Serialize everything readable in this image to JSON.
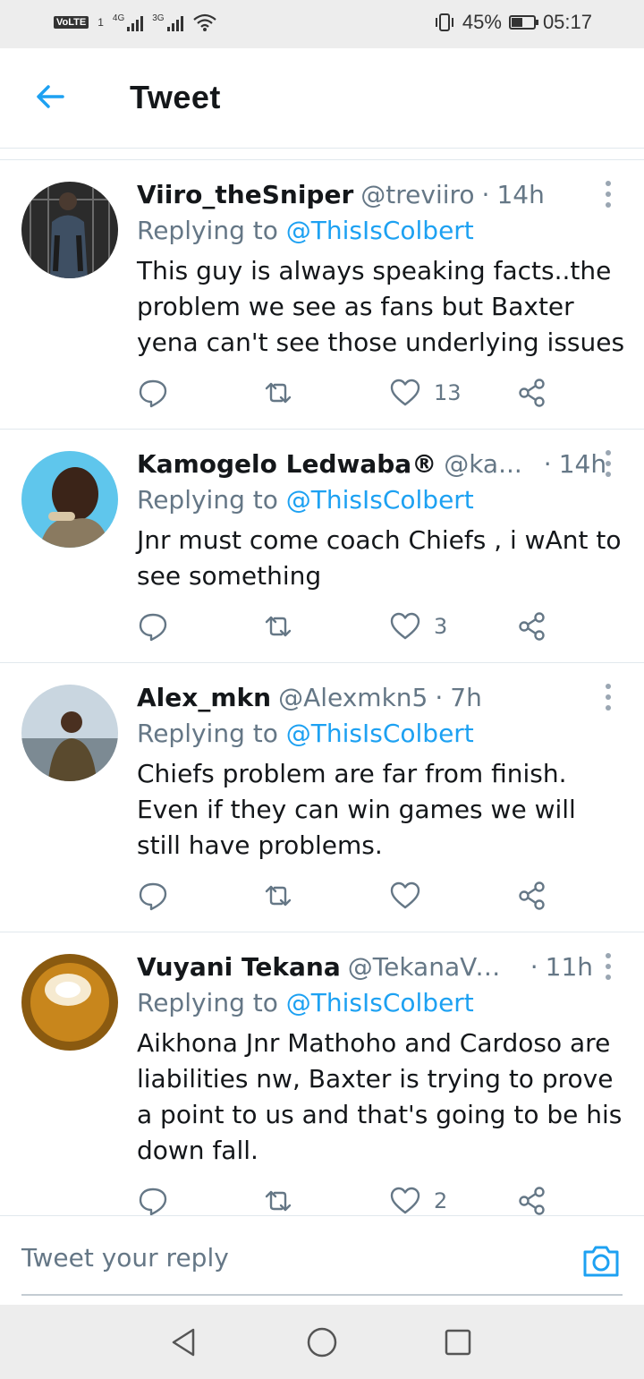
{
  "status": {
    "network_badge": "VoLTE",
    "sim": "1",
    "sig1_label": "4G",
    "sig2_label": "3G",
    "battery": "45%",
    "battery_level": 0.45,
    "time": "05:17"
  },
  "header": {
    "title": "Tweet"
  },
  "tweets": [
    {
      "name": "Viiro_theSniper",
      "handle": "@treviiro",
      "dot": "·",
      "time": "14h",
      "replying_prefix": "Replying to ",
      "replying_to": "@ThisIsColbert",
      "text": "This guy is always speaking facts..the problem we see as fans but Baxter yena can't see those underlying issues",
      "likes": "13"
    },
    {
      "name": "Kamogelo Ledwaba®",
      "handle": "@ka...",
      "dot": "·",
      "time": "14h",
      "replying_prefix": "Replying to ",
      "replying_to": "@ThisIsColbert",
      "text": "Jnr must come coach Chiefs , i wAnt to see something",
      "likes": "3"
    },
    {
      "name": "Alex_mkn",
      "handle": "@Alexmkn5",
      "dot": "·",
      "time": "7h",
      "replying_prefix": "Replying to ",
      "replying_to": "@ThisIsColbert",
      "text": "Chiefs problem are far from finish. Even if they can win games we will still have problems.",
      "likes": ""
    },
    {
      "name": "Vuyani Tekana",
      "handle": "@TekanaVu...",
      "dot": "·",
      "time": "11h",
      "replying_prefix": "Replying to ",
      "replying_to": "@ThisIsColbert",
      "text": "Aikhona Jnr Mathoho and Cardoso are liabilities nw, Baxter is trying to prove a point to us and that's going to be his down fall.",
      "likes": "2"
    }
  ],
  "reply": {
    "placeholder": "Tweet your reply"
  },
  "colors": {
    "accent": "#1da1f2",
    "secondary_text": "#657786",
    "divider": "#e1e8ed"
  },
  "icons": [
    "back-arrow-icon",
    "more-vertical-icon",
    "reply-icon",
    "retweet-icon",
    "like-icon",
    "share-icon",
    "camera-icon",
    "nav-back-icon",
    "nav-home-icon",
    "nav-recents-icon"
  ]
}
